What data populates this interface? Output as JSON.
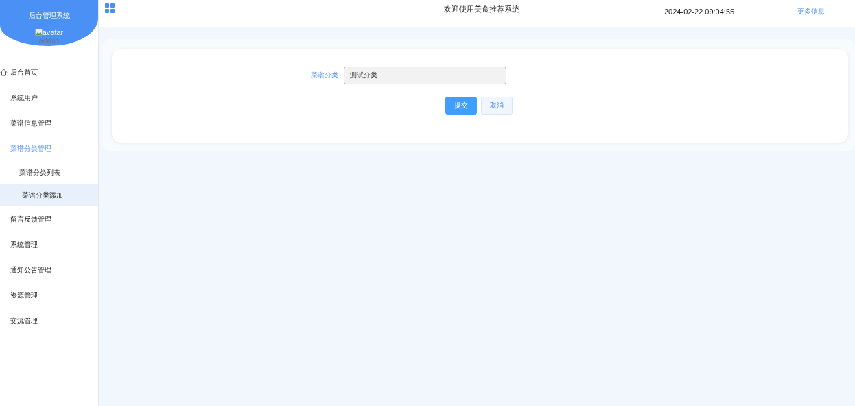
{
  "sidebar": {
    "title": "后台管理系统",
    "avatar_alt": "avatar",
    "username": "admin",
    "items": [
      {
        "label": "后台首页",
        "kind": "home",
        "selected": false,
        "expanded": false
      },
      {
        "label": "系统用户",
        "selected": false,
        "expanded": false
      },
      {
        "label": "菜谱信息管理",
        "selected": false,
        "expanded": false
      },
      {
        "label": "菜谱分类管理",
        "selected": false,
        "expanded": true,
        "children": [
          {
            "label": "菜谱分类列表",
            "selected": false
          },
          {
            "label": "菜谱分类添加",
            "selected": true
          }
        ]
      },
      {
        "label": "留言反馈管理",
        "selected": false,
        "expanded": false
      },
      {
        "label": "系统管理",
        "selected": false,
        "expanded": false
      },
      {
        "label": "通知公告管理",
        "selected": false,
        "expanded": false
      },
      {
        "label": "资源管理",
        "selected": false,
        "expanded": false
      },
      {
        "label": "交流管理",
        "selected": false,
        "expanded": false
      }
    ]
  },
  "header": {
    "welcome": "欢迎使用美食推荐系统",
    "datetime": "2024-02-22 09:04:55",
    "more_link": "更多信息"
  },
  "form": {
    "fields": [
      {
        "label": "菜谱分类",
        "value": "测试分类"
      }
    ],
    "buttons": [
      {
        "label": "提交",
        "kind": "primary"
      },
      {
        "label": "取消",
        "kind": "plain"
      }
    ]
  }
}
